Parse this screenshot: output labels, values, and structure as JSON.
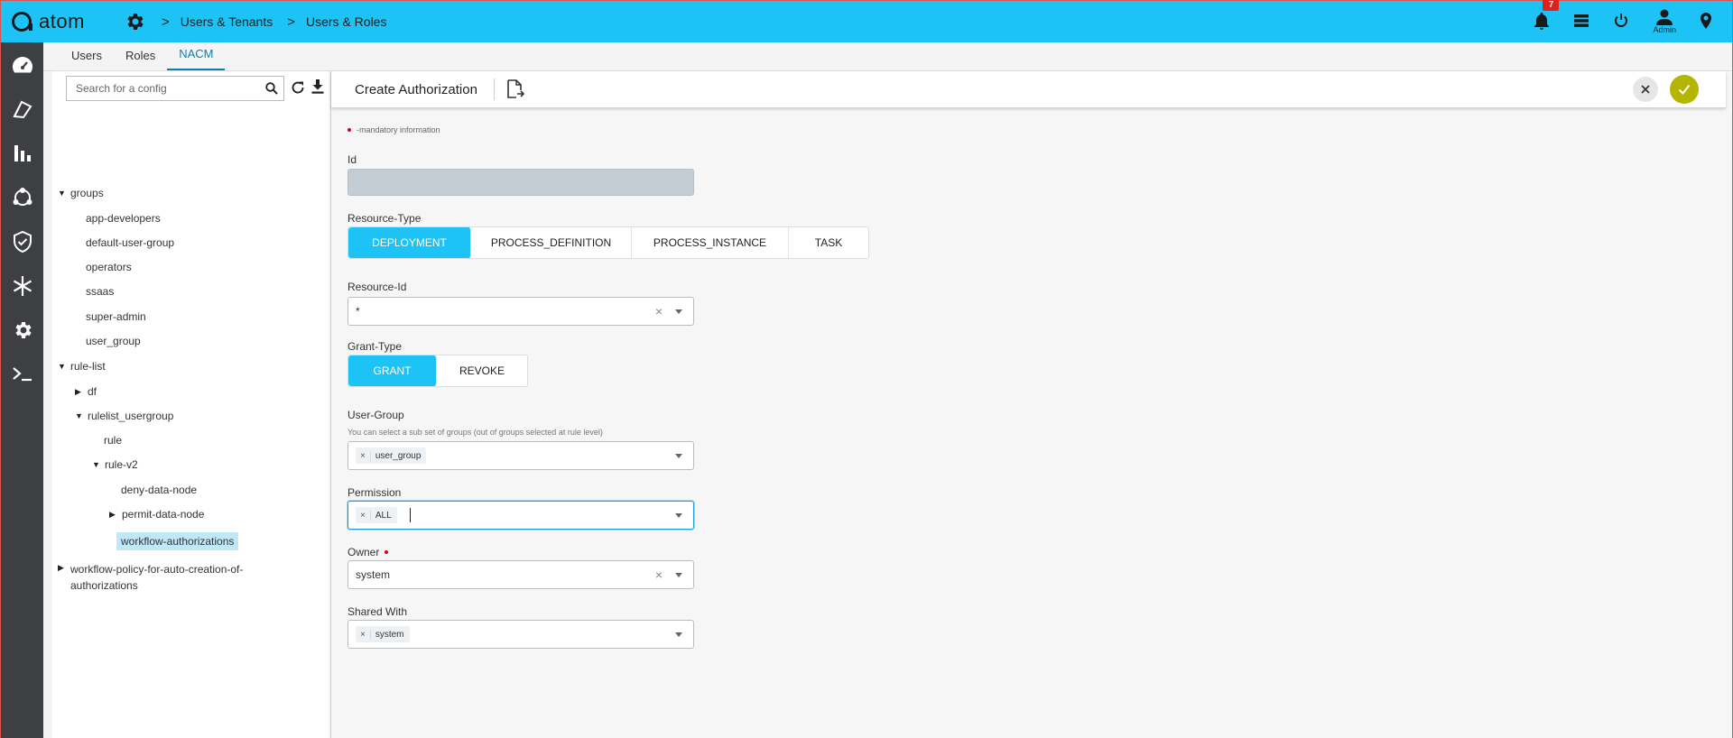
{
  "app": {
    "logo_text": "atom",
    "breadcrumb": [
      "Users & Tenants",
      "Users & Roles"
    ],
    "notifications_count": "7",
    "user_label": "Admin"
  },
  "tabs": [
    {
      "label": "Users",
      "active": false
    },
    {
      "label": "Roles",
      "active": false
    },
    {
      "label": "NACM",
      "active": true
    }
  ],
  "tree": {
    "search_placeholder": "Search for a config",
    "nodes": {
      "groups": "groups",
      "app_developers": "app-developers",
      "default_user_group": "default-user-group",
      "operators": "operators",
      "ssaas": "ssaas",
      "super_admin": "super-admin",
      "user_group": "user_group",
      "rule_list": "rule-list",
      "df": "df",
      "rulelist_usergroup": "rulelist_usergroup",
      "rule": "rule",
      "rule_v2": "rule-v2",
      "deny_data_node": "deny-data-node",
      "permit_data_node": "permit-data-node",
      "workflow_authorizations": "workflow-authorizations",
      "workflow_policy_1": "workflow-policy-for-auto-creation-of-",
      "workflow_policy_2": "authorizations"
    }
  },
  "form": {
    "title": "Create Authorization",
    "mandatory_note": "-mandatory information",
    "id_label": "Id",
    "resource_type_label": "Resource-Type",
    "resource_types": [
      "DEPLOYMENT",
      "PROCESS_DEFINITION",
      "PROCESS_INSTANCE",
      "TASK"
    ],
    "resource_id_label": "Resource-Id",
    "resource_id_value": "*",
    "grant_type_label": "Grant-Type",
    "grant_types": [
      "GRANT",
      "REVOKE"
    ],
    "user_group_label": "User-Group",
    "user_group_hint": "You can select a sub set of groups (out of groups selected at rule level)",
    "user_group_chip": "user_group",
    "permission_label": "Permission",
    "permission_chip": "ALL",
    "owner_label": "Owner",
    "owner_value": "system",
    "shared_with_label": "Shared With",
    "shared_with_chip": "system"
  },
  "colors": {
    "topbar": "#1ec3f6",
    "sidebar": "#3d3f42",
    "accent_active": "#1ec3f6",
    "confirm": "#b5b500",
    "badge": "#e0201b"
  }
}
